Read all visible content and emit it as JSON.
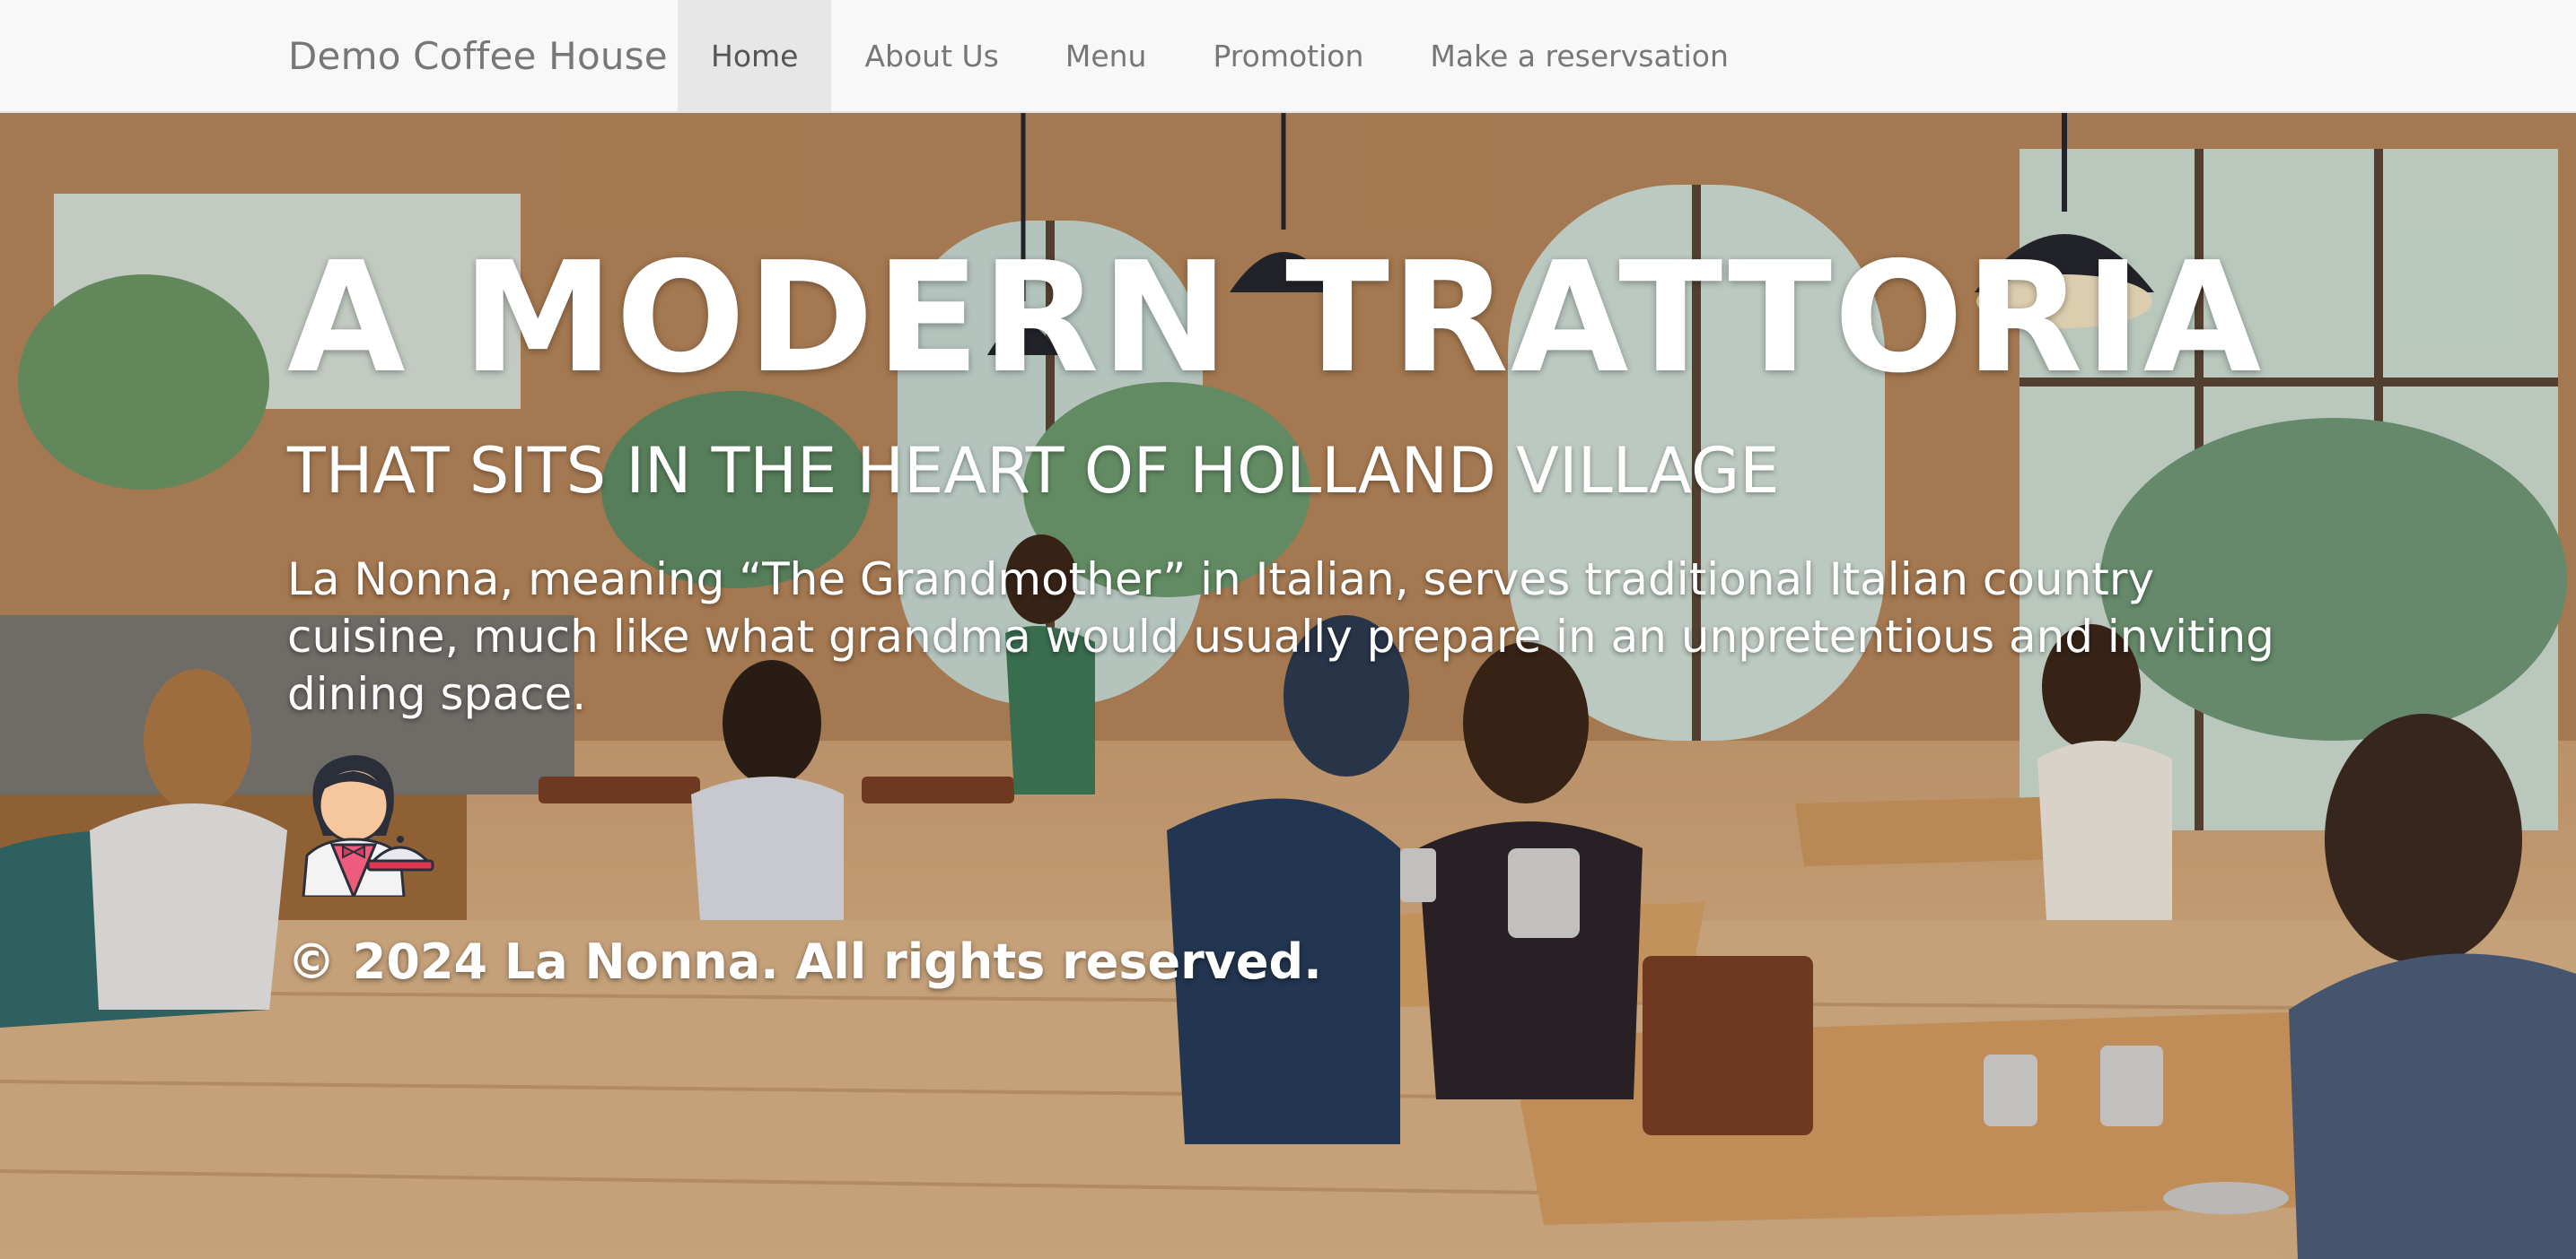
{
  "navbar": {
    "brand": "Demo Coffee House",
    "items": [
      {
        "label": "Home",
        "active": true
      },
      {
        "label": "About Us",
        "active": false
      },
      {
        "label": "Menu",
        "active": false
      },
      {
        "label": "Promotion",
        "active": false
      },
      {
        "label": "Make a reservsation",
        "active": false
      }
    ]
  },
  "hero": {
    "title": "A MODERN TRATTORIA",
    "subtitle": "THAT SITS IN THE HEART OF HOLLAND VILLAGE",
    "description": "La Nonna, meaning “The Grandmother” in Italian, serves traditional Italian country cuisine, much like what grandma would usually prepare in an unpretentious and inviting dining space.",
    "icon": "waiter-icon",
    "background": "cafe-interior-illustration",
    "copyright": "© 2024 La Nonna. All rights reserved."
  },
  "colors": {
    "navbar_bg": "#f8f8f8",
    "nav_text": "#777777",
    "nav_active_bg": "#e7e7e7",
    "hero_text": "#ffffff"
  }
}
